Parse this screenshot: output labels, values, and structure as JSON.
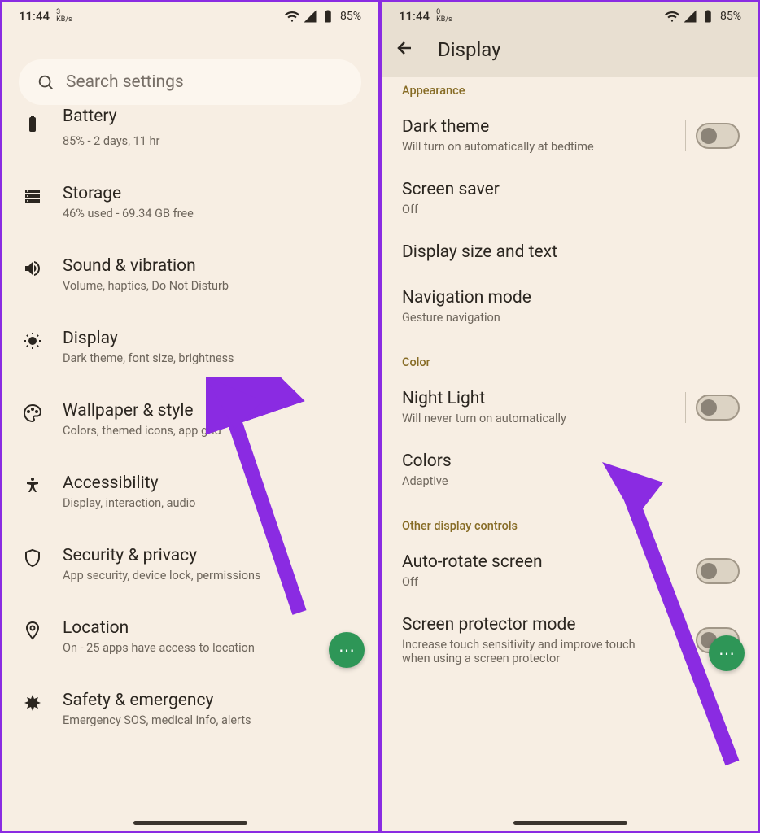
{
  "status": {
    "time": "11:44",
    "net_left_a": "3",
    "net_left_b": "0",
    "kbs": "KB/s",
    "battery": "85%"
  },
  "left": {
    "search_placeholder": "Search settings",
    "items": [
      {
        "title": "Battery",
        "sub": "85% - 2 days, 11 hr"
      },
      {
        "title": "Storage",
        "sub": "46% used - 69.34 GB free"
      },
      {
        "title": "Sound & vibration",
        "sub": "Volume, haptics, Do Not Disturb"
      },
      {
        "title": "Display",
        "sub": "Dark theme, font size, brightness"
      },
      {
        "title": "Wallpaper & style",
        "sub": "Colors, themed icons, app grid"
      },
      {
        "title": "Accessibility",
        "sub": "Display, interaction, audio"
      },
      {
        "title": "Security & privacy",
        "sub": "App security, device lock, permissions"
      },
      {
        "title": "Location",
        "sub": "On - 25 apps have access to location"
      },
      {
        "title": "Safety & emergency",
        "sub": "Emergency SOS, medical info, alerts"
      }
    ]
  },
  "right": {
    "page_title": "Display",
    "section_appearance": "Appearance",
    "section_color": "Color",
    "section_other": "Other display controls",
    "rows": {
      "dark_theme": {
        "title": "Dark theme",
        "sub": "Will turn on automatically at bedtime"
      },
      "screen_saver": {
        "title": "Screen saver",
        "sub": "Off"
      },
      "display_size": {
        "title": "Display size and text"
      },
      "nav_mode": {
        "title": "Navigation mode",
        "sub": "Gesture navigation"
      },
      "night_light": {
        "title": "Night Light",
        "sub": "Will never turn on automatically"
      },
      "colors": {
        "title": "Colors",
        "sub": "Adaptive"
      },
      "auto_rotate": {
        "title": "Auto-rotate screen",
        "sub": "Off"
      },
      "screen_protector": {
        "title": "Screen protector mode",
        "sub": "Increase touch sensitivity and improve touch when using a screen protector"
      }
    }
  }
}
